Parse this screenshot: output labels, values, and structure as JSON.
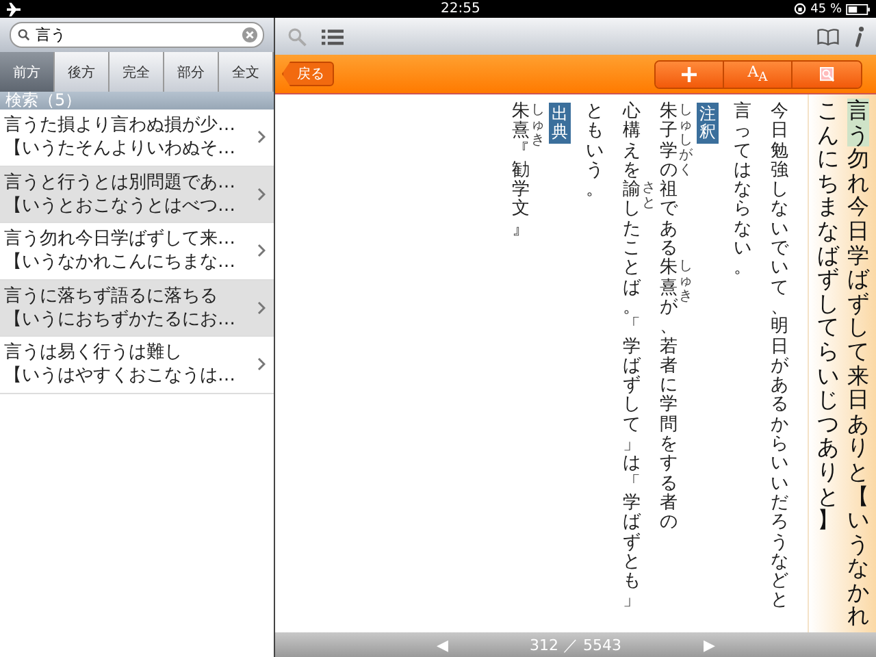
{
  "status_bar": {
    "time": "22:55",
    "battery": "45 %"
  },
  "search": {
    "value": "言う"
  },
  "scope_tabs": [
    {
      "label": "前方",
      "selected": true
    },
    {
      "label": "後方",
      "selected": false
    },
    {
      "label": "完全",
      "selected": false
    },
    {
      "label": "部分",
      "selected": false
    },
    {
      "label": "全文",
      "selected": false
    }
  ],
  "results_header": "検索（5）",
  "results": [
    {
      "title": "言うた損より言わぬ損が少…",
      "reading": "【いうたそんよりいわぬそ…"
    },
    {
      "title": "言うと行うとは別問題であ…",
      "reading": "【いうとおこなうとはべつ…"
    },
    {
      "title": "言う勿れ今日学ばずして来…",
      "reading": "【いうなかれこんにちまな…"
    },
    {
      "title": "言うに落ちず語るに落ちる",
      "reading": "【いうにおちずかたるにお…"
    },
    {
      "title": "言うは易く行うは難し",
      "reading": "【いうはやすくおこなうは…"
    }
  ],
  "back_button": "戻る",
  "font_button": "A$_{A}$",
  "entry": {
    "columns": [
      {
        "kind": "text",
        "segments": [
          {
            "text": "朱熹",
            "ruby": "しゅき"
          },
          {
            "text": "『勧学文』"
          }
        ]
      },
      {
        "kind": "label",
        "text": "出典"
      },
      {
        "kind": "text",
        "segments": [
          {
            "text": "ともいう。"
          }
        ]
      },
      {
        "kind": "text",
        "segments": [
          {
            "text": "心構えを"
          },
          {
            "text": "諭",
            "ruby": "さと"
          },
          {
            "text": "したことば。「学ばずして」は「学ばずとも」"
          }
        ]
      },
      {
        "kind": "text",
        "segments": [
          {
            "text": "朱子学",
            "ruby": "しゅしがく"
          },
          {
            "text": "の祖である"
          },
          {
            "text": "朱熹",
            "ruby": "しゅき"
          },
          {
            "text": "が、若者に学問をする者の"
          }
        ]
      },
      {
        "kind": "label",
        "text": "注釈"
      },
      {
        "kind": "text",
        "segments": [
          {
            "text": "言ってはならない。"
          }
        ]
      },
      {
        "kind": "text",
        "segments": [
          {
            "text": "今日勉強しないでいて、明日があるからいいだろうなどと"
          }
        ]
      }
    ],
    "headword_columns": [
      [
        {
          "text": "こんにちまなばずしてらいじつありと】",
          "kind": "plain"
        }
      ],
      [
        {
          "text": "言う",
          "kind": "highlight"
        },
        {
          "text": "勿れ今日学ばずして来日ありと【いうなかれ",
          "kind": "plain"
        }
      ]
    ]
  },
  "pager": {
    "prev": "◀",
    "page": "312 ／ 5543",
    "next": "▶"
  }
}
